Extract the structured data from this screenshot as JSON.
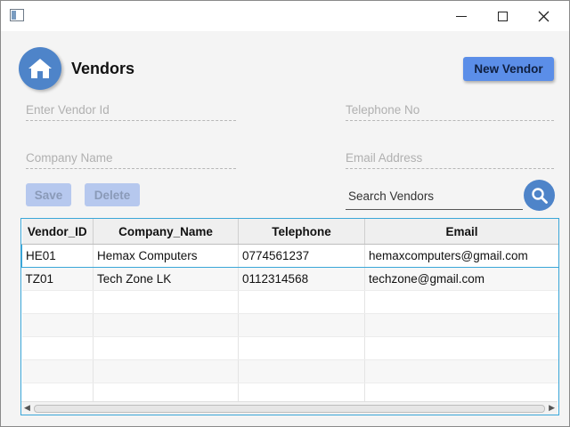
{
  "window": {
    "title": "",
    "controls": [
      "minimize-icon",
      "maximize-icon",
      "close-icon"
    ]
  },
  "header": {
    "icon": "home-icon",
    "title": "Vendors",
    "new_vendor_label": "New Vendor"
  },
  "form": {
    "vendor_id_placeholder": "Enter Vendor Id",
    "telephone_placeholder": "Telephone No",
    "company_placeholder": "Company Name",
    "email_placeholder": "Email Address",
    "save_label": "Save",
    "delete_label": "Delete",
    "search_placeholder": "Search Vendors",
    "search_icon": "search-icon"
  },
  "colors": {
    "accent": "#4e84c9",
    "primary_button": "#5b8ee8",
    "disabled_button": "#b6c8ee",
    "table_border": "#3aa6d8"
  },
  "table": {
    "columns": [
      "Vendor_ID",
      "Company_Name",
      "Telephone",
      "Email"
    ],
    "rows": [
      [
        "HE01",
        "Hemax Computers",
        "0774561237",
        "hemaxcomputers@gmail.com"
      ],
      [
        "TZ01",
        "Tech Zone LK",
        "0112314568",
        "techzone@gmail.com"
      ]
    ]
  }
}
